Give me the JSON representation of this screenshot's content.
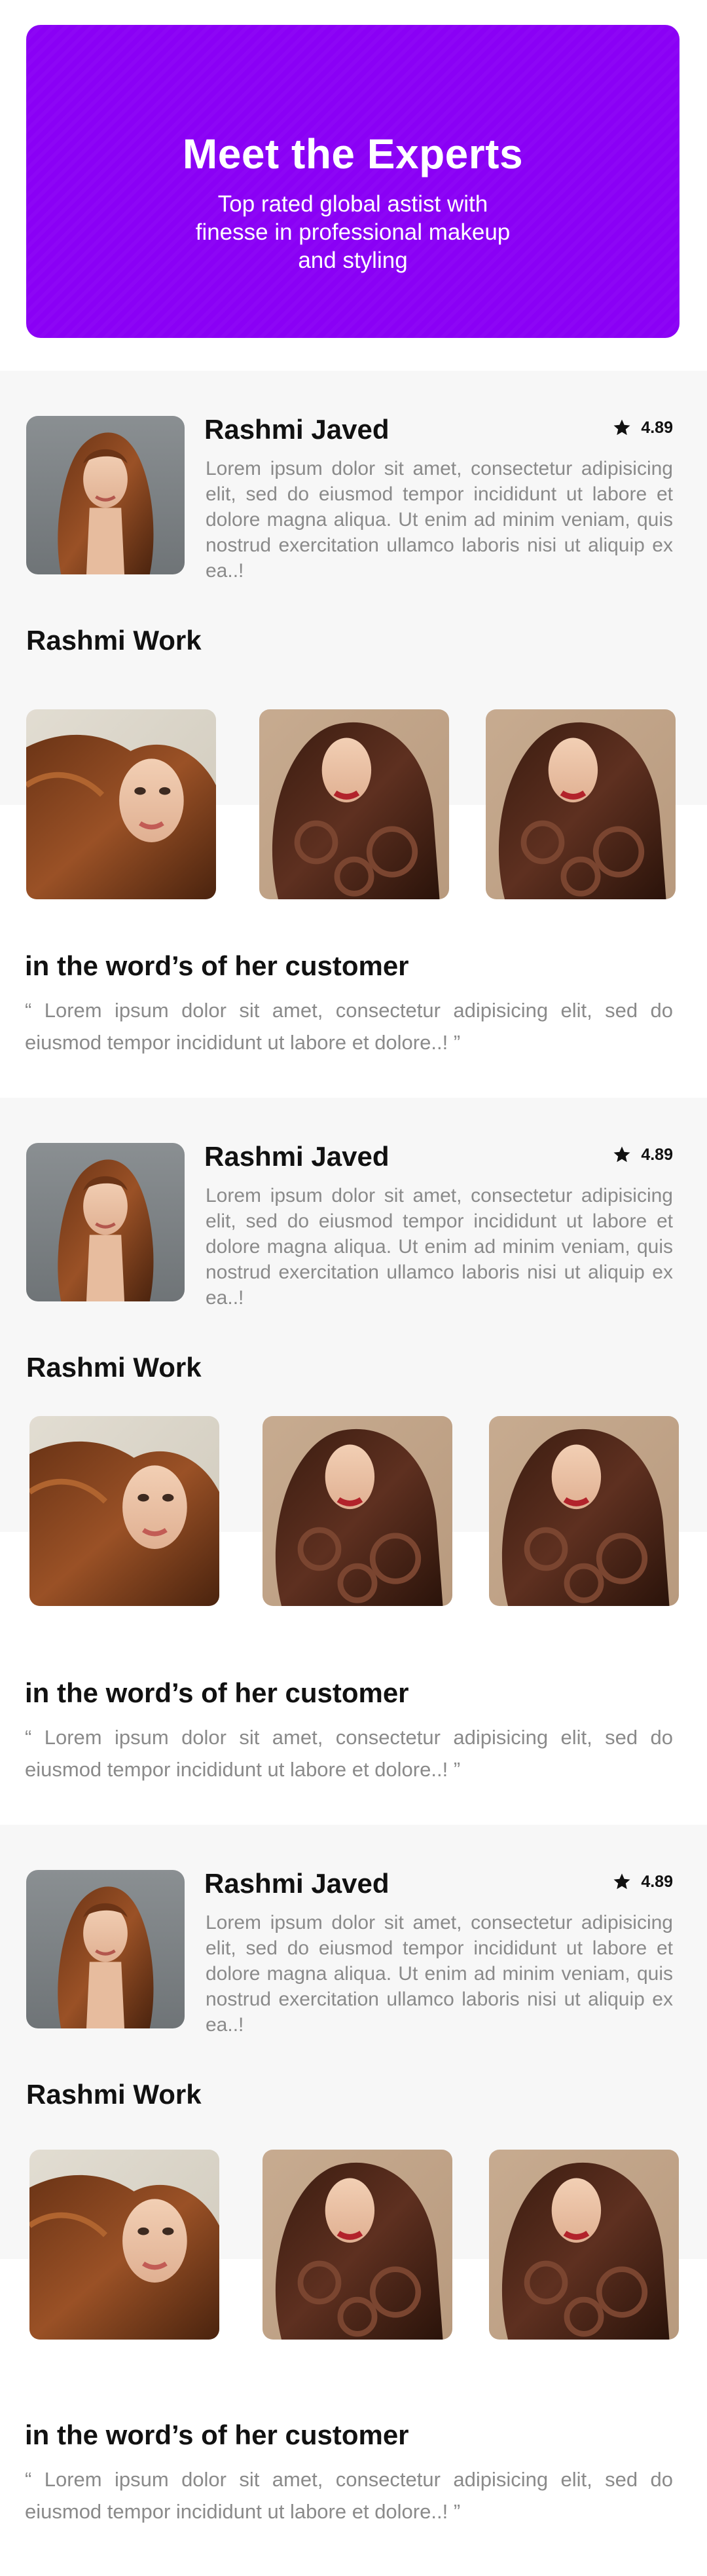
{
  "hero": {
    "title": "Meet the Experts",
    "subtitle": "Top rated global astist with finesse in professional makeup and styling",
    "background": "#8a00f5"
  },
  "experts": [
    {
      "name": "Rashmi Javed",
      "rating": "4.89",
      "rating_icon": "star-icon",
      "bio": "Lorem ipsum dolor sit amet, consectetur adipisicing elit, sed do eiusmod tempor incididunt ut labore et dolore magna aliqua. Ut enim ad minim veniam, quis nostrud exercitation ullamco laboris nisi ut aliquip ex ea..!",
      "work_title": "Rashmi Work",
      "testimonial_title": "in the word’s of her customer",
      "testimonial": "“ Lorem ipsum dolor sit amet, consectetur adipisicing elit, sed do eiusmod tempor incididunt ut labore et dolore..! ”"
    },
    {
      "name": "Rashmi Javed",
      "rating": "4.89",
      "rating_icon": "star-icon",
      "bio": "Lorem ipsum dolor sit amet, consectetur adipisicing elit, sed do eiusmod tempor incididunt ut labore et dolore magna aliqua. Ut enim ad minim veniam, quis nostrud exercitation ullamco laboris nisi ut aliquip ex ea..!",
      "work_title": "Rashmi Work",
      "testimonial_title": "in the word’s of her customer",
      "testimonial": "“ Lorem ipsum dolor sit amet, consectetur adipisicing elit, sed do eiusmod tempor incididunt ut labore et dolore..! ”"
    },
    {
      "name": "Rashmi Javed",
      "rating": "4.89",
      "rating_icon": "star-icon",
      "bio": "Lorem ipsum dolor sit amet, consectetur adipisicing elit, sed do eiusmod tempor incididunt ut labore et dolore magna aliqua. Ut enim ad minim veniam, quis nostrud exercitation ullamco laboris nisi ut aliquip ex ea..!",
      "work_title": "Rashmi Work",
      "testimonial_title": "in the word’s of her customer",
      "testimonial": "“ Lorem ipsum dolor sit amet, consectetur adipisicing elit, sed do eiusmod tempor incididunt ut labore et dolore..! ”"
    }
  ]
}
